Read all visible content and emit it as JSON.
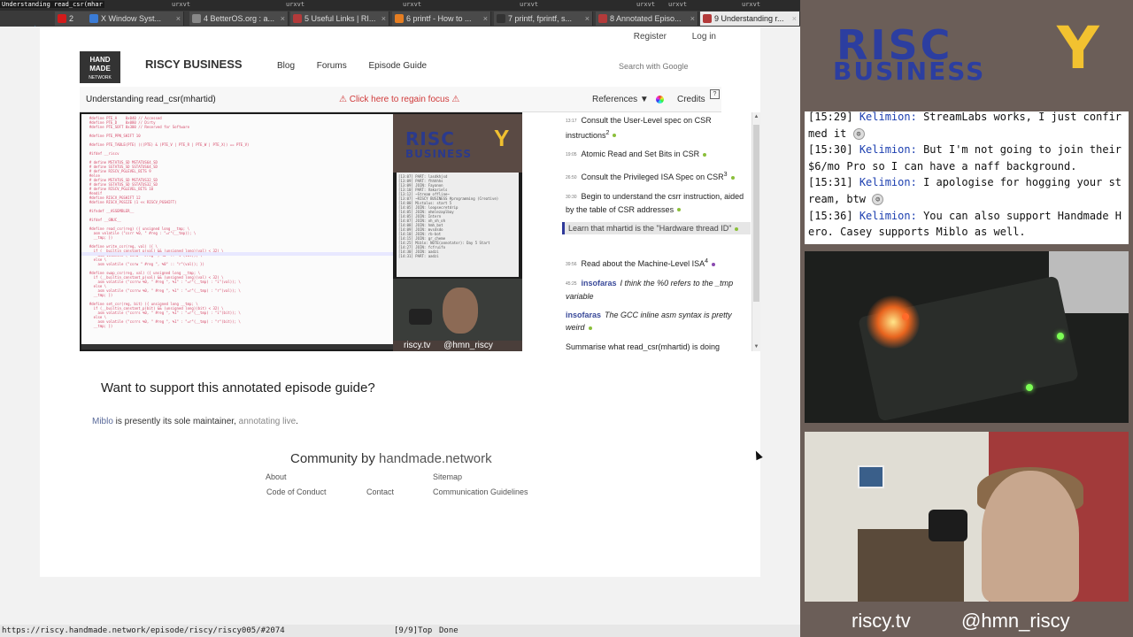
{
  "tabbar": {
    "segments": [
      {
        "label": "Understanding read_csr(mhar",
        "active": true
      },
      {
        "label": "urxvt"
      },
      {
        "label": "urxvt"
      },
      {
        "label": "urxvt"
      },
      {
        "label": "urxvt"
      },
      {
        "label": "urxvt"
      },
      {
        "label": "urxvt"
      },
      {
        "label": "urxvt"
      }
    ]
  },
  "tabs": [
    {
      "label": "2",
      "icon": "youtube-icon",
      "color": "#d31b1b"
    },
    {
      "label": "X Window Syst...",
      "icon": "web-icon",
      "color": "#3a7bd5"
    },
    {
      "label": "4 BetterOS.org : a...",
      "icon": "page-icon",
      "color": "#888888"
    },
    {
      "label": "5 Useful Links | RI...",
      "icon": "grid-icon",
      "color": "#b33a3a"
    },
    {
      "label": "6 printf - How to ...",
      "icon": "flame-icon",
      "color": "#e67e22"
    },
    {
      "label": "7 printf, fprintf, s...",
      "icon": "c-icon",
      "color": "#333333"
    },
    {
      "label": "8 Annotated Episo...",
      "icon": "grid-icon",
      "color": "#b33a3a"
    },
    {
      "label": "9 Understanding r...",
      "icon": "grid-icon",
      "color": "#b33a3a",
      "active": true
    }
  ],
  "page": {
    "topnav": {
      "register": "Register",
      "login": "Log in"
    },
    "logo": {
      "line1": "HAND",
      "line2": "MADE",
      "line3": "NETWORK"
    },
    "site_title": "RISCY BUSINESS",
    "mainnav": {
      "blog": "Blog",
      "forums": "Forums",
      "episode_guide": "Episode Guide"
    },
    "search_placeholder": "Search with Google",
    "player": {
      "title": "Understanding read_csr(mhartid)",
      "focus_warning": "⚠ Click here to regain focus ⚠",
      "references": "References ▼",
      "credits": "Credits",
      "help": "?"
    },
    "video": {
      "mini_brand_a": "riscy.tv",
      "mini_brand_b": "@hmn_riscy",
      "logo_l1": "RISC",
      "logo_l2": "BUSINESS",
      "logo_y": "Y"
    },
    "markers": [
      {
        "ts": "13:17",
        "text": "Consult the User-Level spec on CSR instructions",
        "sup": "2",
        "dot": "green"
      },
      {
        "ts": "19:05",
        "text": "Atomic Read and Set Bits in CSR",
        "dot": "green"
      },
      {
        "ts": "26:50",
        "text": "Consult the Privileged ISA Spec on CSR",
        "sup": "3",
        "dot": "green"
      },
      {
        "ts": "30:30",
        "text": "Begin to understand the csrr instruction, aided by the table of CSR addresses",
        "dot": "green"
      },
      {
        "ts": "",
        "text": "Learn that mhartid is the \"Hardware thread ID\"",
        "dot": "green",
        "current": true
      },
      {
        "ts": "39:56",
        "text": "Read about the Machine-Level ISA",
        "sup": "4",
        "dot": "purple"
      },
      {
        "ts": "45:25",
        "author": "insofaras",
        "text": "I think the %0 refers to the _tmp variable",
        "chat": true
      },
      {
        "ts": "",
        "author": "insofaras",
        "text": "The GCC inline asm syntax is pretty weird",
        "chat": true,
        "dot": "green"
      },
      {
        "ts": "",
        "text": "Summarise what read_csr(mhartid) is doing"
      }
    ],
    "support": {
      "heading": "Want to support this annotated episode guide?",
      "maintainer": "Miblo",
      "middle": " is presently its sole maintainer, ",
      "annotating": "annotating live",
      "end": "."
    },
    "community": {
      "prefix": "Community by ",
      "brand": "handmade.network"
    },
    "footer": {
      "about": "About",
      "sitemap": "Sitemap",
      "code_of_conduct": "Code of Conduct",
      "contact": "Contact",
      "communication_guidelines": "Communication Guidelines"
    }
  },
  "statusbar": {
    "url": "https://riscy.handmade.network/episode/riscy/riscy005/#2074",
    "position": "[9/9]Top",
    "state": "Done"
  },
  "stream": {
    "brand_riscy": "RISC",
    "brand_business": "BUSINESS",
    "brand_y": "Y",
    "chat": [
      {
        "time": "[15:29]",
        "nick": "Kelimion:",
        "text": " StreamLabs works, I just confirmed it "
      },
      {
        "time": "[15:30]",
        "nick": "Kelimion:",
        "text": " But I'm not going to join their $6/mo Pro so I can have a naff background."
      },
      {
        "time": "[15:31]",
        "nick": "Kelimion:",
        "text": " I apologise for hogging your stream, btw "
      },
      {
        "time": "[15:36]",
        "nick": "Kelimion:",
        "text": " You can also support Handmade Hero. Casey supports Miblo as well."
      }
    ],
    "footer_a": "riscy.tv",
    "footer_b": "@hmn_riscy"
  },
  "colors": {
    "accent_blue": "#2c3ea0",
    "accent_yellow": "#f2c230",
    "warning_red": "#d03a3a",
    "marker_dot": "#8bbf3a"
  }
}
